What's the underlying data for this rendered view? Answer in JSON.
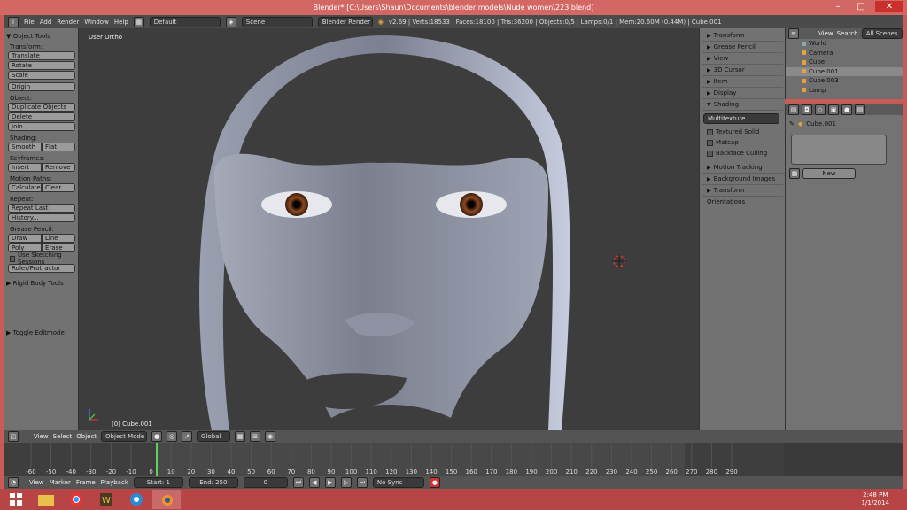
{
  "window": {
    "title": "Blender* [C:\\Users\\Shaun\\Documents\\blender models\\Nude women\\223.blend]"
  },
  "menu": {
    "file": "File",
    "add": "Add",
    "render": "Render",
    "window": "Window",
    "help": "Help",
    "layout": "Default",
    "scene": "Scene",
    "engine": "Blender Render",
    "stats": "v2.69 | Verts:18533 | Faces:18100 | Tris:36200 | Objects:0/5 | Lamps:0/1 | Mem:20.60M (0.44M) | Cube.001"
  },
  "toolshelf": {
    "title": "Object Tools",
    "transform": "Transform:",
    "translate": "Translate",
    "rotate": "Rotate",
    "scale": "Scale",
    "origin": "Origin",
    "object": "Object:",
    "duplicate": "Duplicate Objects",
    "delete": "Delete",
    "join": "Join",
    "shading": "Shading:",
    "smooth": "Smooth",
    "flat": "Flat",
    "keyframes": "Keyframes:",
    "insert": "Insert",
    "remove": "Remove",
    "motion": "Motion Paths:",
    "calculate": "Calculate",
    "clear": "Clear",
    "repeat": "Repeat:",
    "repeat_last": "Repeat Last",
    "history": "History...",
    "grease": "Grease Pencil:",
    "draw": "Draw",
    "line": "Line",
    "poly": "Poly",
    "erase": "Erase",
    "sketch": "Use Sketching Sessions",
    "ruler": "Ruler/Protractor",
    "rigid": "Rigid Body Tools",
    "toggle": "Toggle Editmode"
  },
  "viewport": {
    "label": "User Ortho",
    "object": "(0) Cube.001"
  },
  "nprops": {
    "transform": "Transform",
    "grease": "Grease Pencil",
    "view": "View",
    "cursor": "3D Cursor",
    "item": "Item",
    "display": "Display",
    "shading": "Shading",
    "multitex": "Multitexture",
    "textured": "Textured Solid",
    "matcap": "Matcap",
    "backface": "Backface Culling",
    "motion": "Motion Tracking",
    "bg": "Background Images",
    "orient": "Transform Orientations"
  },
  "outliner": {
    "view": "View",
    "search": "Search",
    "scenes": "All Scenes",
    "items": [
      "World",
      "Camera",
      "Cube",
      "Cube.001",
      "Cube.003",
      "Lamp"
    ]
  },
  "properties": {
    "object": "Cube.001",
    "new": "New"
  },
  "viewheader": {
    "view": "View",
    "select": "Select",
    "object": "Object",
    "mode": "Object Mode",
    "global": "Global"
  },
  "timeline": {
    "ticks": [
      "-60",
      "-50",
      "-40",
      "-30",
      "-20",
      "-10",
      "0",
      "10",
      "20",
      "30",
      "40",
      "50",
      "60",
      "70",
      "80",
      "90",
      "100",
      "110",
      "120",
      "130",
      "140",
      "150",
      "160",
      "170",
      "180",
      "190",
      "200",
      "210",
      "220",
      "230",
      "240",
      "250",
      "260",
      "270",
      "280",
      "290"
    ],
    "view": "View",
    "marker": "Marker",
    "frame": "Frame",
    "playback": "Playback",
    "start": "Start: 1",
    "end": "End: 250",
    "current": "0",
    "sync": "No Sync"
  },
  "clock": {
    "time": "2:48 PM",
    "date": "1/1/2014"
  }
}
